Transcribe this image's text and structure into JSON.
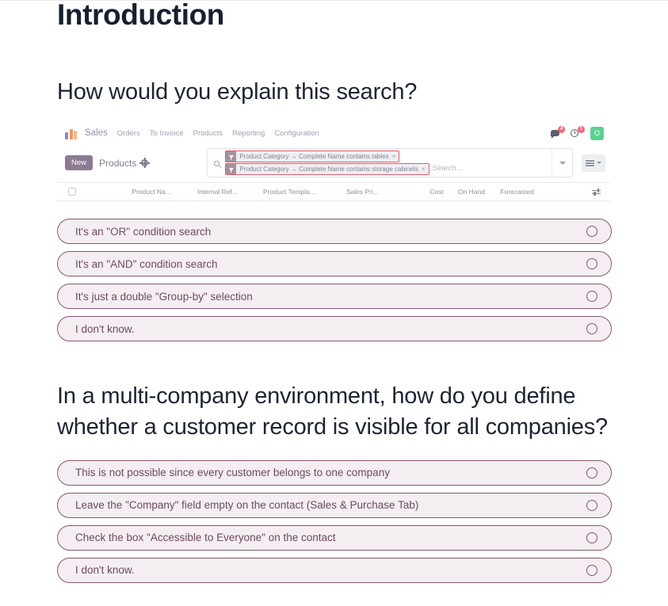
{
  "page": {
    "title": "Introduction"
  },
  "questions": [
    {
      "id": "q-search-condition",
      "heading": "How would you explain this search?",
      "options": [
        "It's an \"OR\" condition search",
        "It's an \"AND\" condition search",
        "It's just a double \"Group-by\" selection",
        "I don't know."
      ]
    },
    {
      "id": "q-multi-company-visibility",
      "heading": "In a multi-company environment, how do you define whether a customer record is visible for all companies?",
      "options": [
        "This is not possible since every customer belongs to one company",
        "Leave the \"Company\" field empty on the contact (Sales & Purchase Tab)",
        "Check the box \"Accessible to Everyone\" on the contact",
        "I don't know."
      ]
    }
  ],
  "odoo_screenshot": {
    "navbar": {
      "logo_icon": "odoo-bars-logo-icon",
      "app_name": "Sales",
      "menu_items": [
        "Orders",
        "To Invoice",
        "Products",
        "Reporting",
        "Configuration"
      ],
      "messages_icon": "chat-bubble-icon",
      "messages_badge": "4",
      "activities_icon": "clock-icon",
      "activities_badge": "1",
      "avatar_initial": "O"
    },
    "control_panel": {
      "new_button": "New",
      "breadcrumb": "Products",
      "breadcrumb_icon": "gear-icon",
      "search_icon": "magnifier-icon",
      "facets": [
        {
          "icon": "filter-funnel-icon",
          "label": "Product Category → Complete Name contains tables",
          "remove": "×"
        },
        {
          "icon": "filter-funnel-icon",
          "label": "Product Category → Complete Name contains storage cabinets",
          "remove": "×"
        }
      ],
      "search_placeholder": "Search...",
      "dropdown_icon": "chevron-down-icon",
      "view_switcher_icon": "list-view-icon",
      "view_switcher_caret": "chevron-down-icon"
    },
    "table": {
      "select_all_icon": "checkbox-icon",
      "columns": [
        "Product Na...",
        "Internal Ref...",
        "Product Templa...",
        "Sales Pri...",
        "Cost",
        "On Hand",
        "Forecasted"
      ],
      "optional_columns_icon": "sliders-icon"
    }
  },
  "colors": {
    "heading": "#1d2433",
    "option_border": "#86566f",
    "option_fill": "#f4eef2",
    "option_text": "#6e4a5f",
    "facet_highlight": "#e8596b",
    "odoo_new_button": "#8c7a92",
    "badge": "#f06a7a",
    "avatar": "#5ad18f"
  }
}
